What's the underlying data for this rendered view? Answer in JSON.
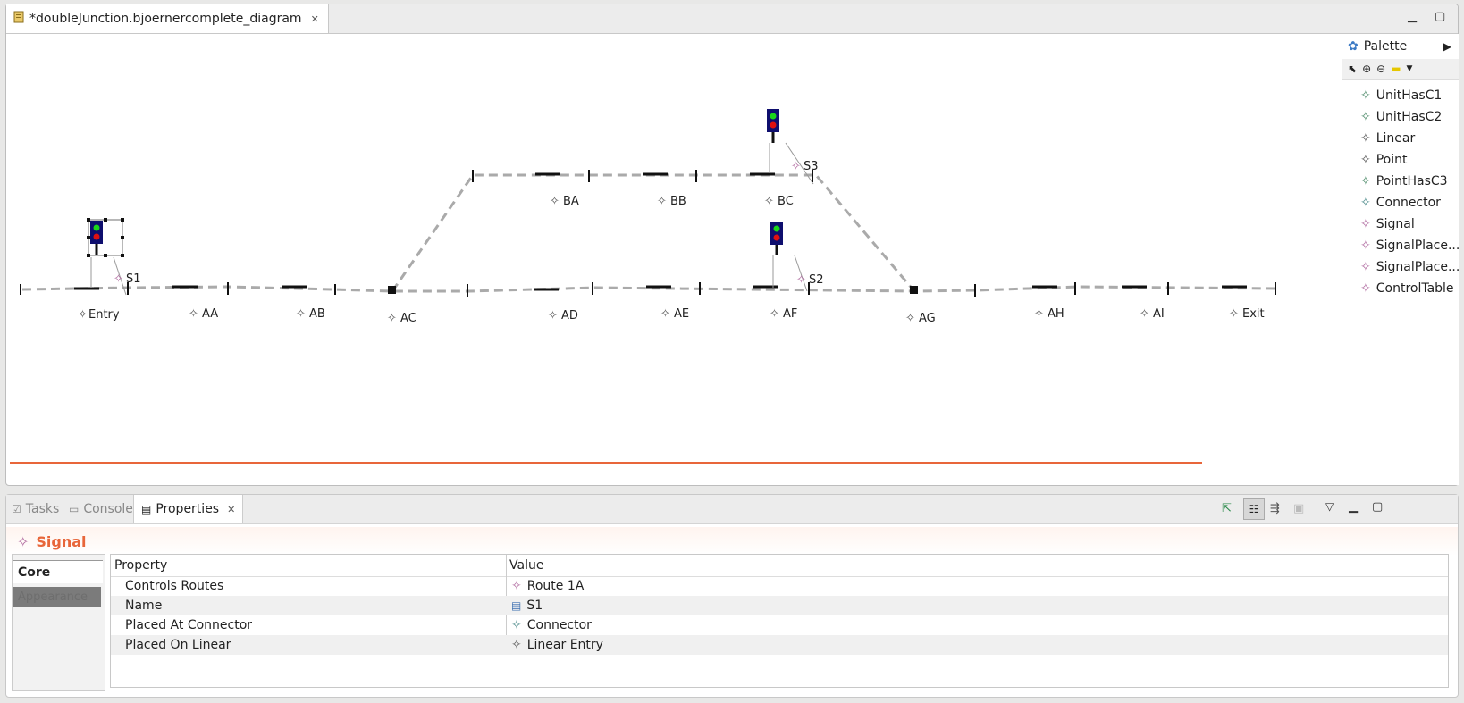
{
  "editor": {
    "tab_title": "*doubleJunction.bjoernercomplete_diagram",
    "tab_icon": "diagram-file-icon"
  },
  "diagram": {
    "linears": [
      "Entry",
      "AA",
      "AB",
      "AC",
      "AD",
      "AE",
      "AF",
      "AG",
      "AH",
      "AI",
      "Exit",
      "BA",
      "BB",
      "BC"
    ],
    "signals": [
      "S1",
      "S2",
      "S3"
    ]
  },
  "palette": {
    "title": "Palette",
    "items": [
      "UnitHasC1",
      "UnitHasC2",
      "Linear",
      "Point",
      "PointHasC3",
      "Connector",
      "Signal",
      "SignalPlace...",
      "SignalPlace...",
      "ControlTable"
    ]
  },
  "bottom": {
    "tabs": [
      "Tasks",
      "Console",
      "Properties"
    ],
    "active_tab": "Properties",
    "selected_type": "Signal",
    "side_tabs": [
      "Core",
      "Appearance"
    ],
    "columns": [
      "Property",
      "Value"
    ],
    "rows": [
      {
        "property": "Controls Routes",
        "value": "Route 1A"
      },
      {
        "property": "Name",
        "value": "S1"
      },
      {
        "property": "Placed At Connector",
        "value": "Connector"
      },
      {
        "property": "Placed On Linear",
        "value": "Linear Entry"
      }
    ]
  },
  "colors": {
    "accent": "#e8663a",
    "track": "#aaaaaa",
    "signal_body": "#0e0e6e"
  }
}
